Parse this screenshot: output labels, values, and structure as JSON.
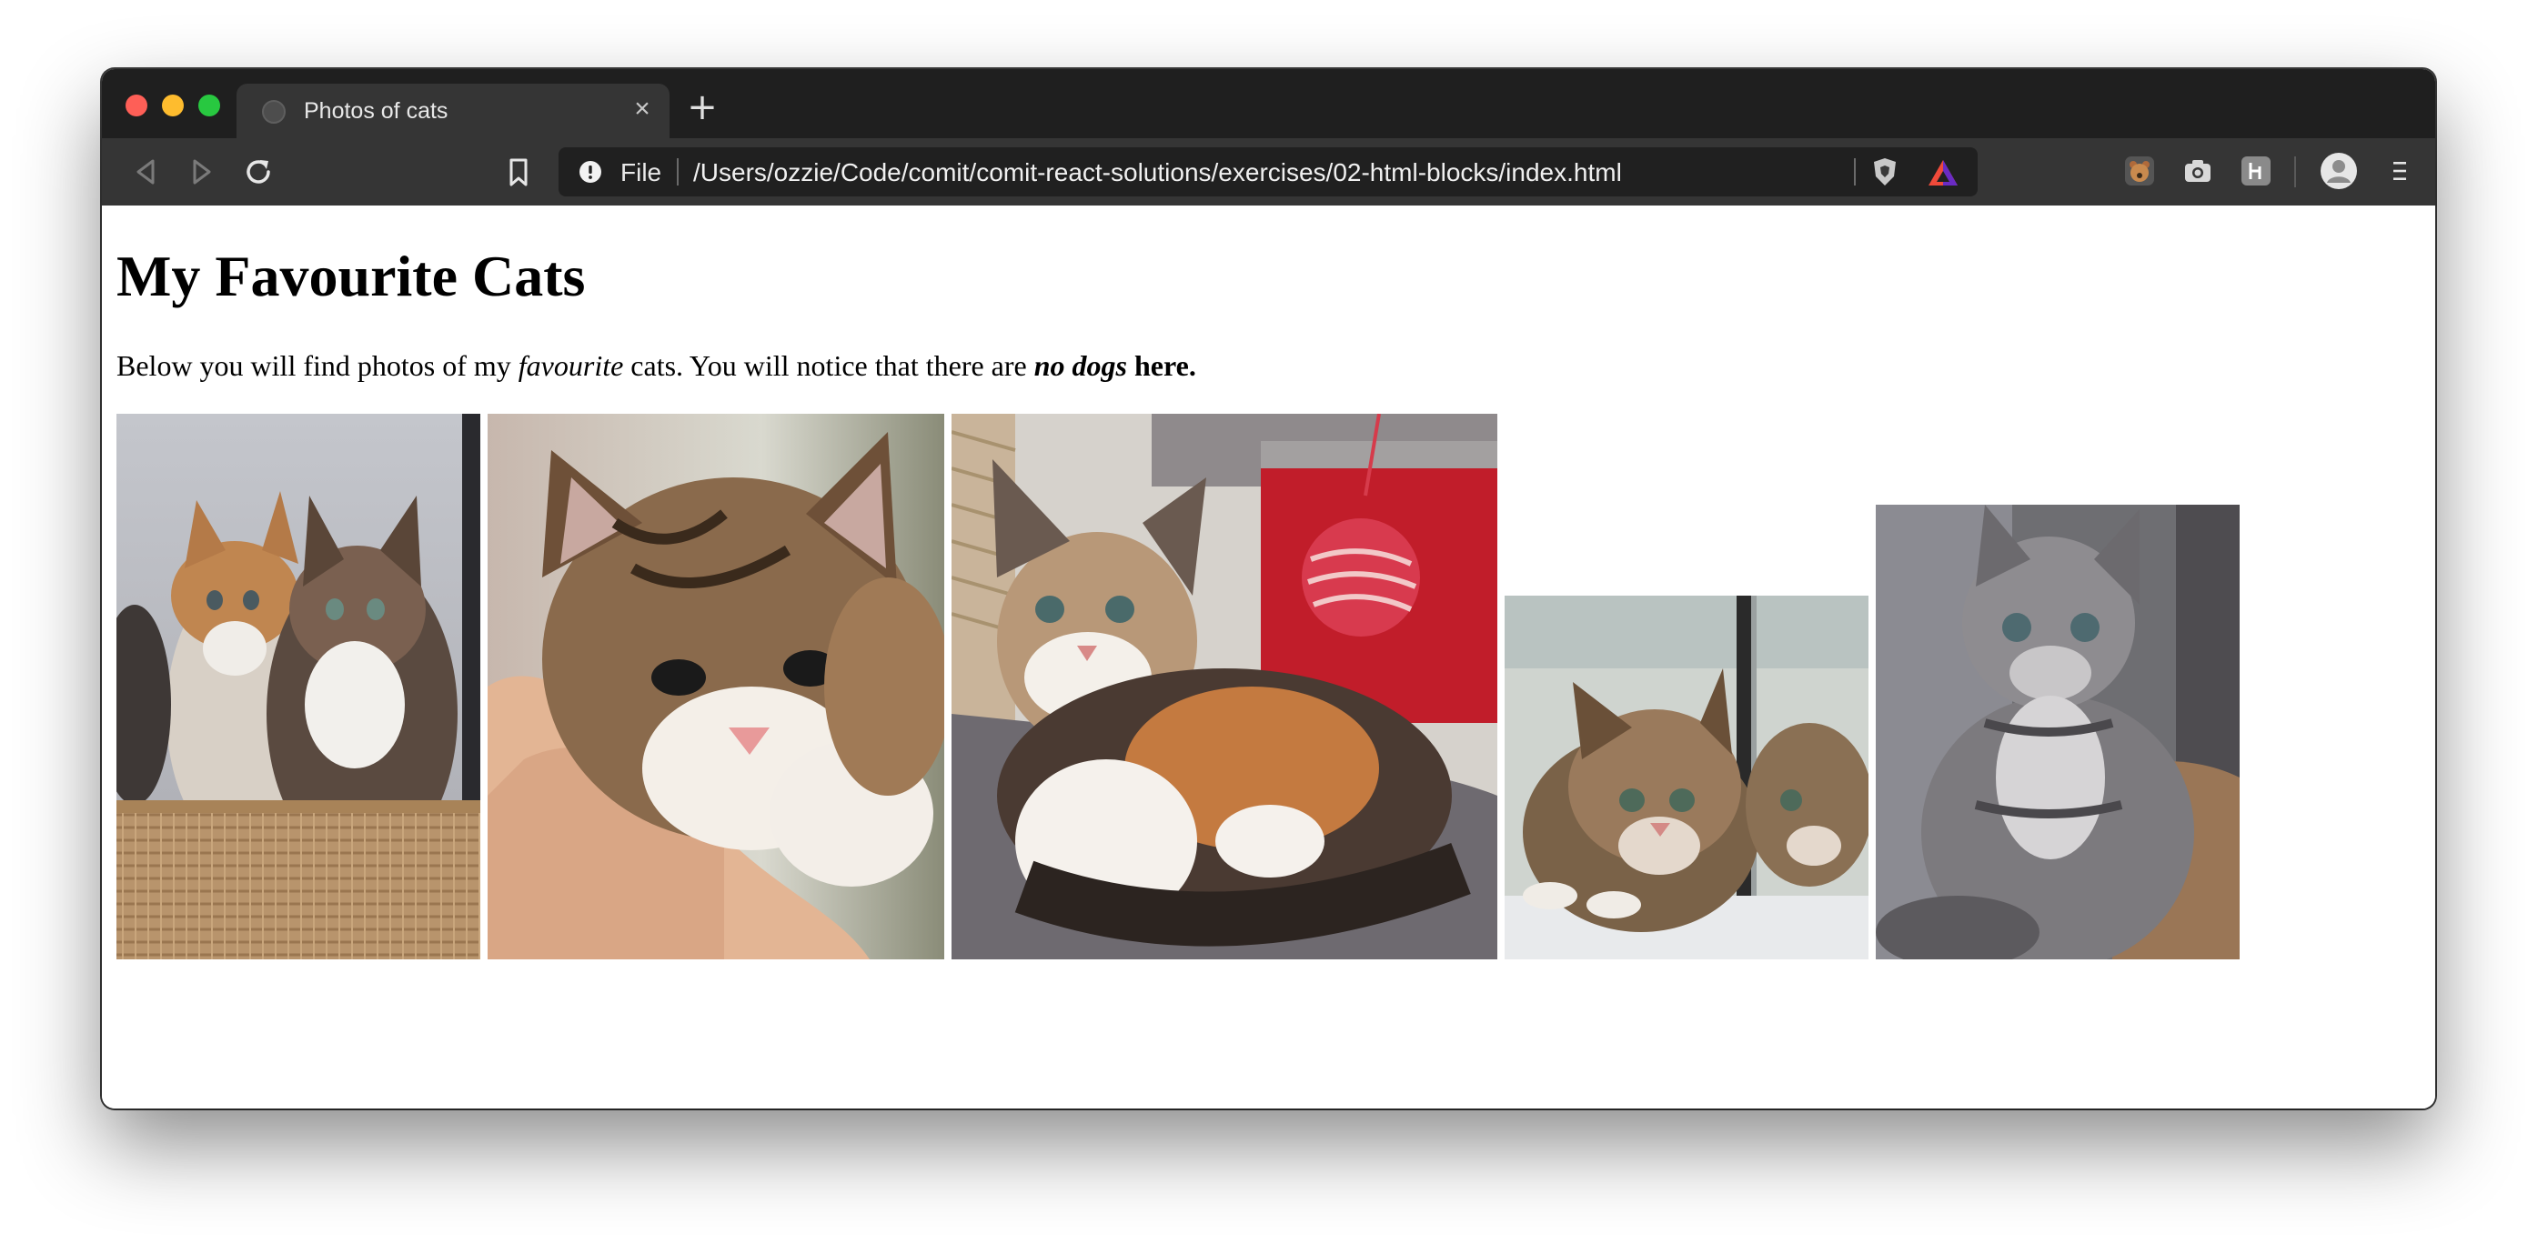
{
  "browser": {
    "tab": {
      "title": "Photos of cats",
      "close_glyph": "×"
    },
    "new_tab_glyph": "+",
    "address_bar": {
      "scheme_label": "File",
      "url": "/Users/ozzie/Code/comit/comit-react-solutions/exercises/02-html-blocks/index.html"
    },
    "icons": [
      "back-icon",
      "forward-icon",
      "reload-icon",
      "bookmark-icon",
      "info-icon",
      "brave-shields-icon",
      "brave-rewards-icon",
      "extension-bear-icon",
      "extension-camera-icon",
      "extension-h-icon",
      "profile-icon",
      "menu-icon"
    ],
    "colors": {
      "tabstrip": "#1f1f1f",
      "toolbar": "#353535",
      "omnibox": "#202020",
      "close": "#fe5f57",
      "minimize": "#febc2e",
      "zoom": "#28c840"
    }
  },
  "page": {
    "heading": "My Favourite Cats",
    "intro": {
      "before": "Below you will find photos of my ",
      "emphasis": "favourite",
      "middle": " cats. You will notice that there are ",
      "bold_italic": "no dogs",
      "bold": " here."
    },
    "photos": [
      {
        "name": "two-kittens-in-basket"
      },
      {
        "name": "kitten-on-hand"
      },
      {
        "name": "calico-kitten-with-ball"
      },
      {
        "name": "kitten-with-mirror"
      },
      {
        "name": "grey-tabby-kitten"
      }
    ]
  }
}
